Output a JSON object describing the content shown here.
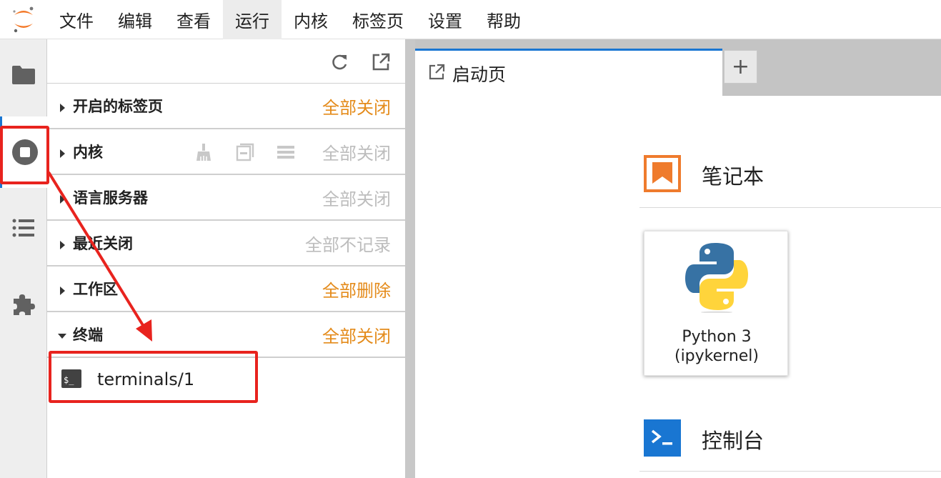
{
  "menubar": {
    "items": [
      "文件",
      "编辑",
      "查看",
      "运行",
      "内核",
      "标签页",
      "设置",
      "帮助"
    ],
    "active_index": 3
  },
  "activitybar": {
    "items": [
      {
        "icon": "folder-icon"
      },
      {
        "icon": "running-kernels-icon",
        "active": true
      },
      {
        "icon": "table-of-contents-icon"
      },
      {
        "icon": "extension-puzzle-icon"
      }
    ]
  },
  "sidepanel": {
    "toolbar": {
      "refresh_icon": "refresh-icon",
      "open_icon": "launch-icon"
    },
    "sections": [
      {
        "title": "开启的标签页",
        "action": "全部关闭",
        "enabled": true,
        "expanded": false
      },
      {
        "title": "内核",
        "action": "全部关闭",
        "enabled": false,
        "expanded": false
      },
      {
        "title": "语言服务器",
        "action": "全部关闭",
        "enabled": false,
        "expanded": false
      },
      {
        "title": "最近关闭",
        "action": "全部不记录",
        "enabled": false,
        "expanded": false
      },
      {
        "title": "工作区",
        "action": "全部删除",
        "enabled": true,
        "expanded": false
      },
      {
        "title": "终端",
        "action": "全部关闭",
        "enabled": true,
        "expanded": true
      }
    ],
    "terminal_item": {
      "label": "terminals/1",
      "icon": "terminal-icon"
    }
  },
  "tabs": {
    "launcher_label": "启动页",
    "add_label": "+"
  },
  "launcher": {
    "notebook_title": "笔记本",
    "kernel_card_line1": "Python 3",
    "kernel_card_line2": "(ipykernel)",
    "console_title": "控制台"
  },
  "colors": {
    "accent": "#1976d2",
    "orange": "#e48b1b",
    "annotation_red": "#e8231e"
  }
}
